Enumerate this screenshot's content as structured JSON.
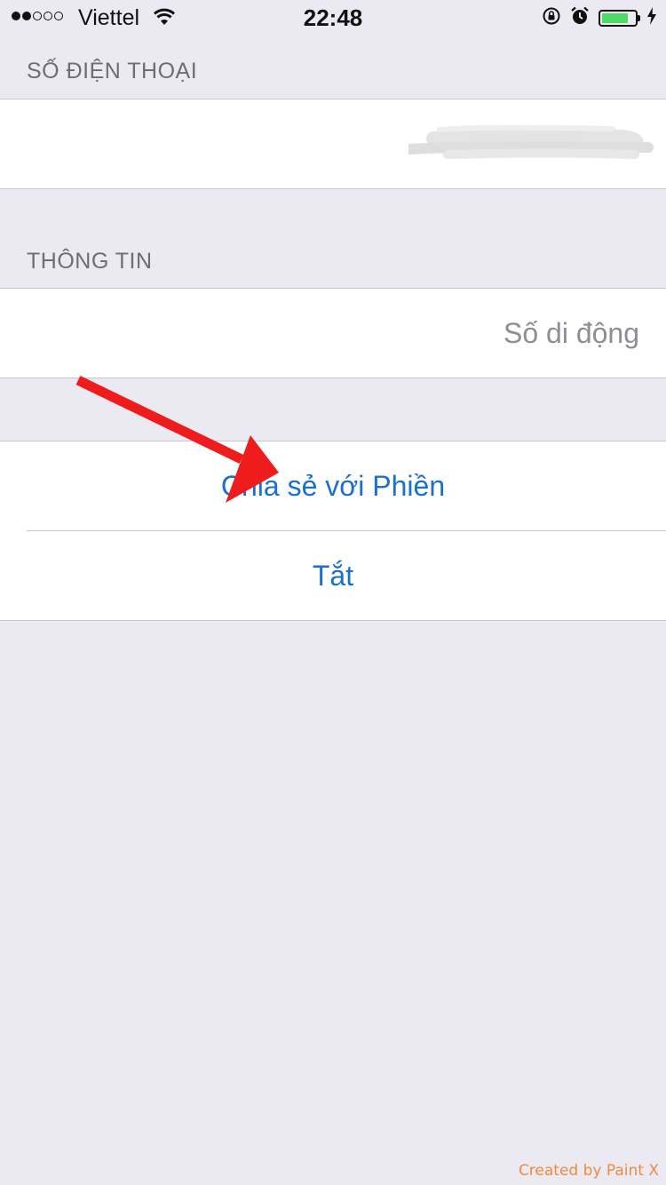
{
  "status_bar": {
    "carrier": "Viettel",
    "time": "22:48",
    "signal_bars_filled": 2,
    "signal_bars_total": 5,
    "battery_level": 0.8,
    "battery_color": "#4cd964"
  },
  "phone_section": {
    "header": "SỐ ĐIỆN THOẠI"
  },
  "info_section": {
    "header": "THÔNG TIN",
    "value": "Số di động"
  },
  "actions": {
    "share_label": "Chia sẻ với Phiền",
    "off_label": "Tắt"
  },
  "watermark": "Created by Paint X",
  "colors": {
    "background": "#ebeaf2",
    "action_blue": "#1a6fd0",
    "detail_gray": "#8e8e93",
    "annotation_red": "#ee1c1c"
  }
}
